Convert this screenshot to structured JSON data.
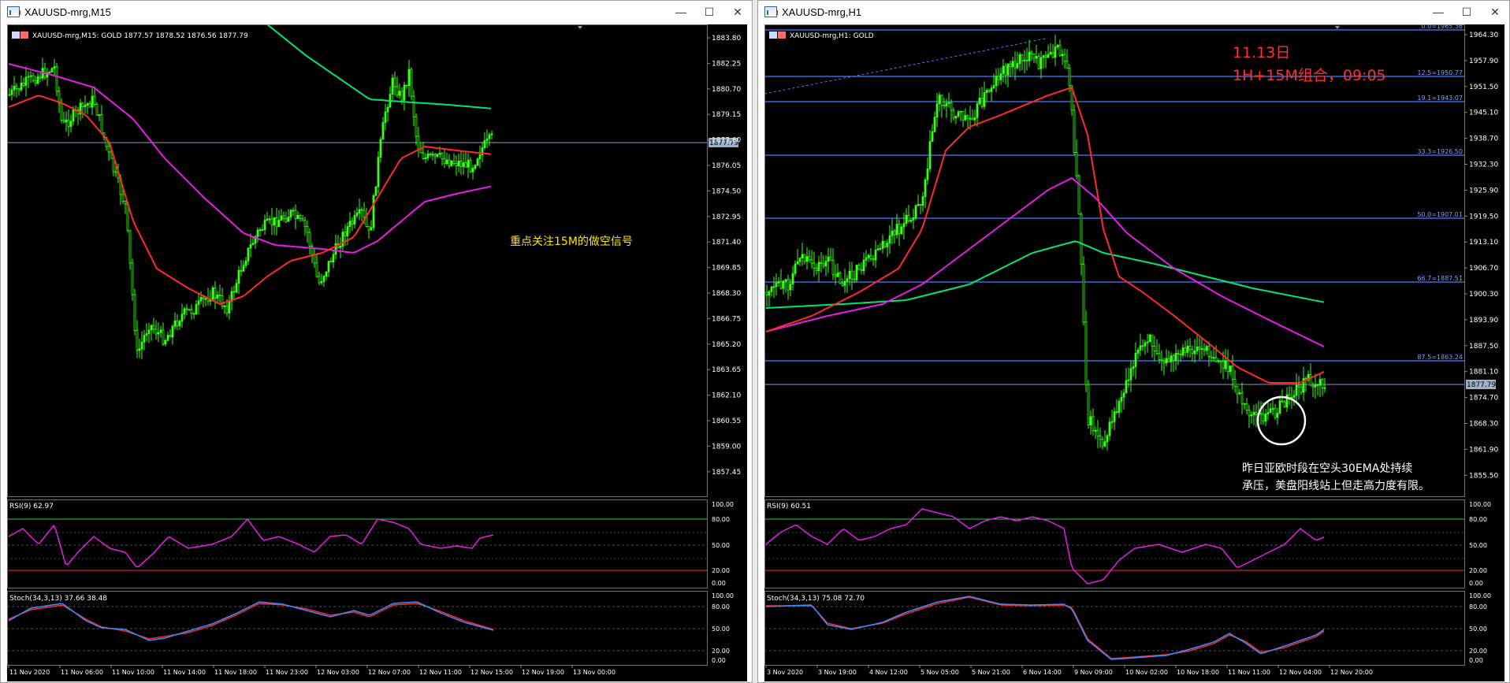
{
  "left_window": {
    "title": "XAUUSD-mrg,M15",
    "chart_header": "XAUUSD-mrg,M15:  GOLD  1877.57 1878.52 1876.56 1877.79",
    "price_labels": [
      "1883.80",
      "1882.25",
      "1880.70",
      "1879.15",
      "1877.60",
      "1876.05",
      "1874.50",
      "1872.95",
      "1871.40",
      "1869.85",
      "1868.30",
      "1866.75",
      "1865.20",
      "1863.65",
      "1862.10",
      "1860.55",
      "1859.00",
      "1857.45"
    ],
    "current_price": "1877.79",
    "annotation": "重点关注15M的做空信号",
    "rsi_label": "RSI(9) 62.97",
    "rsi_scale": [
      "100.00",
      "80.00",
      "50.00",
      "20.00",
      "0.00"
    ],
    "stoch_label": "Stoch(34,3,13) 37.66 38.48",
    "stoch_scale": [
      "100.00",
      "80.00",
      "50.00",
      "20.00",
      "0.00"
    ],
    "time_labels": [
      "11 Nov 2020",
      "11 Nov 06:00",
      "11 Nov 10:00",
      "11 Nov 14:00",
      "11 Nov 18:00",
      "11 Nov 23:00",
      "12 Nov 03:00",
      "12 Nov 07:00",
      "12 Nov 11:00",
      "12 Nov 15:00",
      "12 Nov 19:00",
      "13 Nov 00:00"
    ]
  },
  "right_window": {
    "title": "XAUUSD-mrg,H1",
    "chart_header": "XAUUSD-mrg,H1:  GOLD",
    "price_labels": [
      "1964.30",
      "1957.90",
      "1951.50",
      "1945.10",
      "1938.70",
      "1932.30",
      "1925.90",
      "1919.50",
      "1913.10",
      "1906.70",
      "1900.30",
      "1893.90",
      "1887.50",
      "1881.10",
      "1874.70",
      "1868.30",
      "1861.90",
      "1855.50"
    ],
    "current_price": "1877.79",
    "fib_levels": [
      "0.0=1965.36",
      "12.5=1950.77",
      "19.1=1943.07",
      "33.3=1926.50",
      "50.0=1907.01",
      "66.7=1887.51",
      "87.5=1863.24"
    ],
    "annotation_date": "11.13日",
    "annotation_combo": "1H+15M组合，09:05",
    "annotation_note_1": "昨日亚欧时段在空头30EMA处持续",
    "annotation_note_2": "承压，美盘阳线站上但走高力度有限。",
    "rsi_label": "RSI(9) 60.51",
    "rsi_scale": [
      "100.00",
      "80.00",
      "50.00",
      "20.00",
      "0.00"
    ],
    "stoch_label": "Stoch(34,3,13) 75.08 72.70",
    "stoch_scale": [
      "100.00",
      "80.00",
      "50.00",
      "20.00",
      "0.00"
    ],
    "time_labels": [
      "3 Nov 2020",
      "3 Nov 19:00",
      "4 Nov 12:00",
      "5 Nov 05:00",
      "5 Nov 21:00",
      "6 Nov 14:00",
      "9 Nov 09:00",
      "10 Nov 02:00",
      "10 Nov 18:00",
      "11 Nov 11:00",
      "12 Nov 04:00",
      "12 Nov 20:00"
    ]
  },
  "colors": {
    "candle": "#39ff14",
    "ema_fast": "#ff2a2a",
    "ema_mid": "#e81ee8",
    "ema_slow": "#00e676",
    "fib": "#4a7dff",
    "annotation_yellow": "#ffe600",
    "annotation_red": "#ff3030",
    "stoch_main": "#3a8cff",
    "stoch_signal": "#ff2a2a"
  },
  "icons": {
    "window_icon": "chart-window-icon",
    "minimize": "minimize-icon",
    "maximize": "maximize-icon",
    "close": "close-icon"
  }
}
